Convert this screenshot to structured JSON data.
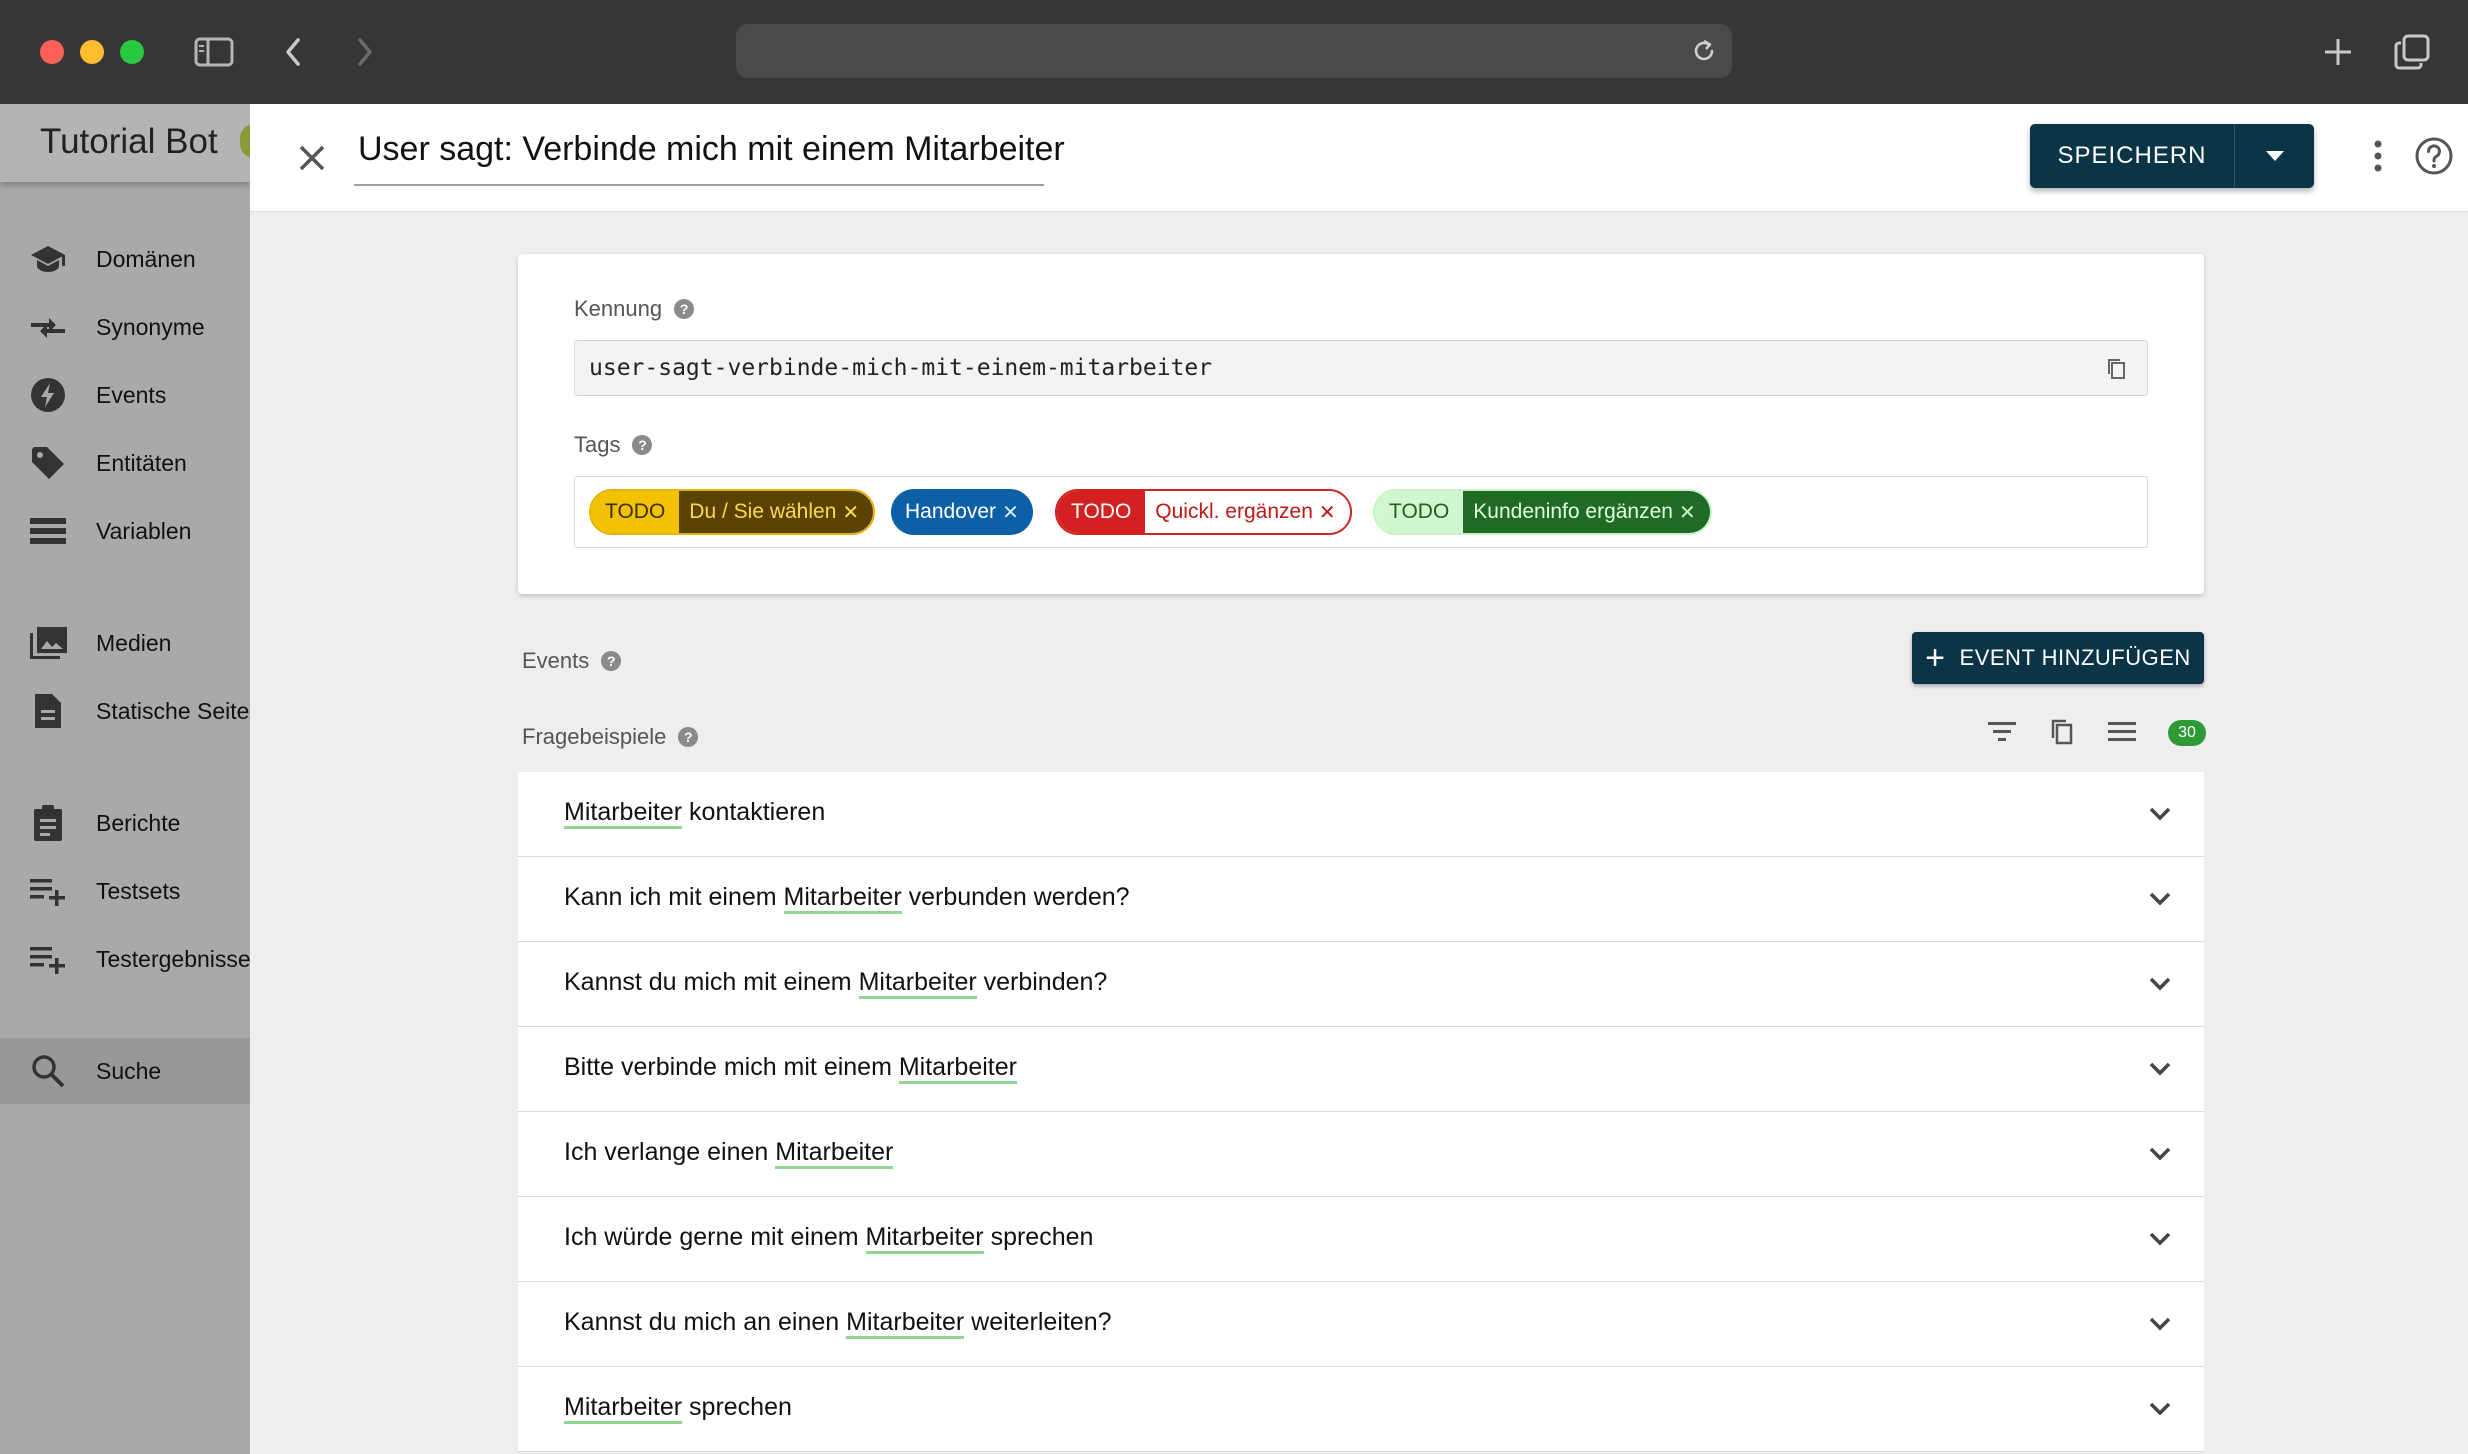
{
  "browser": {
    "url": ""
  },
  "app": {
    "title": "Tutorial Bot"
  },
  "sidebar": {
    "items": [
      {
        "label": "Domänen",
        "icon": "school-icon"
      },
      {
        "label": "Synonyme",
        "icon": "compare-arrows-icon"
      },
      {
        "label": "Events",
        "icon": "bolt-icon"
      },
      {
        "label": "Entitäten",
        "icon": "tag-icon"
      },
      {
        "label": "Variablen",
        "icon": "list-icon"
      },
      {
        "label": "Medien",
        "icon": "photo-library-icon"
      },
      {
        "label": "Statische Seiten",
        "icon": "document-icon"
      },
      {
        "label": "Berichte",
        "icon": "clipboard-icon"
      },
      {
        "label": "Testsets",
        "icon": "playlist-add-icon"
      },
      {
        "label": "Testergebnisse",
        "icon": "playlist-add-icon"
      },
      {
        "label": "Suche",
        "icon": "search-icon",
        "active": true
      }
    ]
  },
  "dialog": {
    "title": "User sagt: Verbinde mich mit einem Mitarbeiter",
    "save_label": "SPEICHERN",
    "kennung_label": "Kennung",
    "kennung_value": "user-sagt-verbinde-mich-mit-einem-mitarbeiter",
    "tags_label": "Tags",
    "tags": [
      {
        "prefix": "TODO",
        "text": "Du / Sie wählen",
        "color": "#f2c200"
      },
      {
        "prefix": "",
        "text": "Handover",
        "color": "#0d5fa6"
      },
      {
        "prefix": "TODO",
        "text": "Quickl. ergänzen",
        "color": "#d32020"
      },
      {
        "prefix": "TODO",
        "text": "Kundeninfo ergänzen",
        "color": "#1f7a26"
      }
    ],
    "events_label": "Events",
    "add_event_label": "EVENT HINZUFÜGEN",
    "examples_label": "Fragebeispiele",
    "examples_count": "30",
    "examples": [
      {
        "before": "",
        "entity": "Mitarbeiter",
        "after": " kontaktieren"
      },
      {
        "before": "Kann ich mit einem ",
        "entity": "Mitarbeiter",
        "after": " verbunden werden?"
      },
      {
        "before": "Kannst du mich mit einem ",
        "entity": "Mitarbeiter",
        "after": " verbinden?"
      },
      {
        "before": "Bitte verbinde mich mit einem ",
        "entity": "Mitarbeiter",
        "after": ""
      },
      {
        "before": "Ich verlange einen ",
        "entity": "Mitarbeiter",
        "after": ""
      },
      {
        "before": "Ich würde gerne mit einem ",
        "entity": "Mitarbeiter",
        "after": " sprechen"
      },
      {
        "before": "Kannst du mich an einen ",
        "entity": "Mitarbeiter",
        "after": " weiterleiten?"
      },
      {
        "before": "",
        "entity": "Mitarbeiter",
        "after": " sprechen"
      }
    ]
  }
}
